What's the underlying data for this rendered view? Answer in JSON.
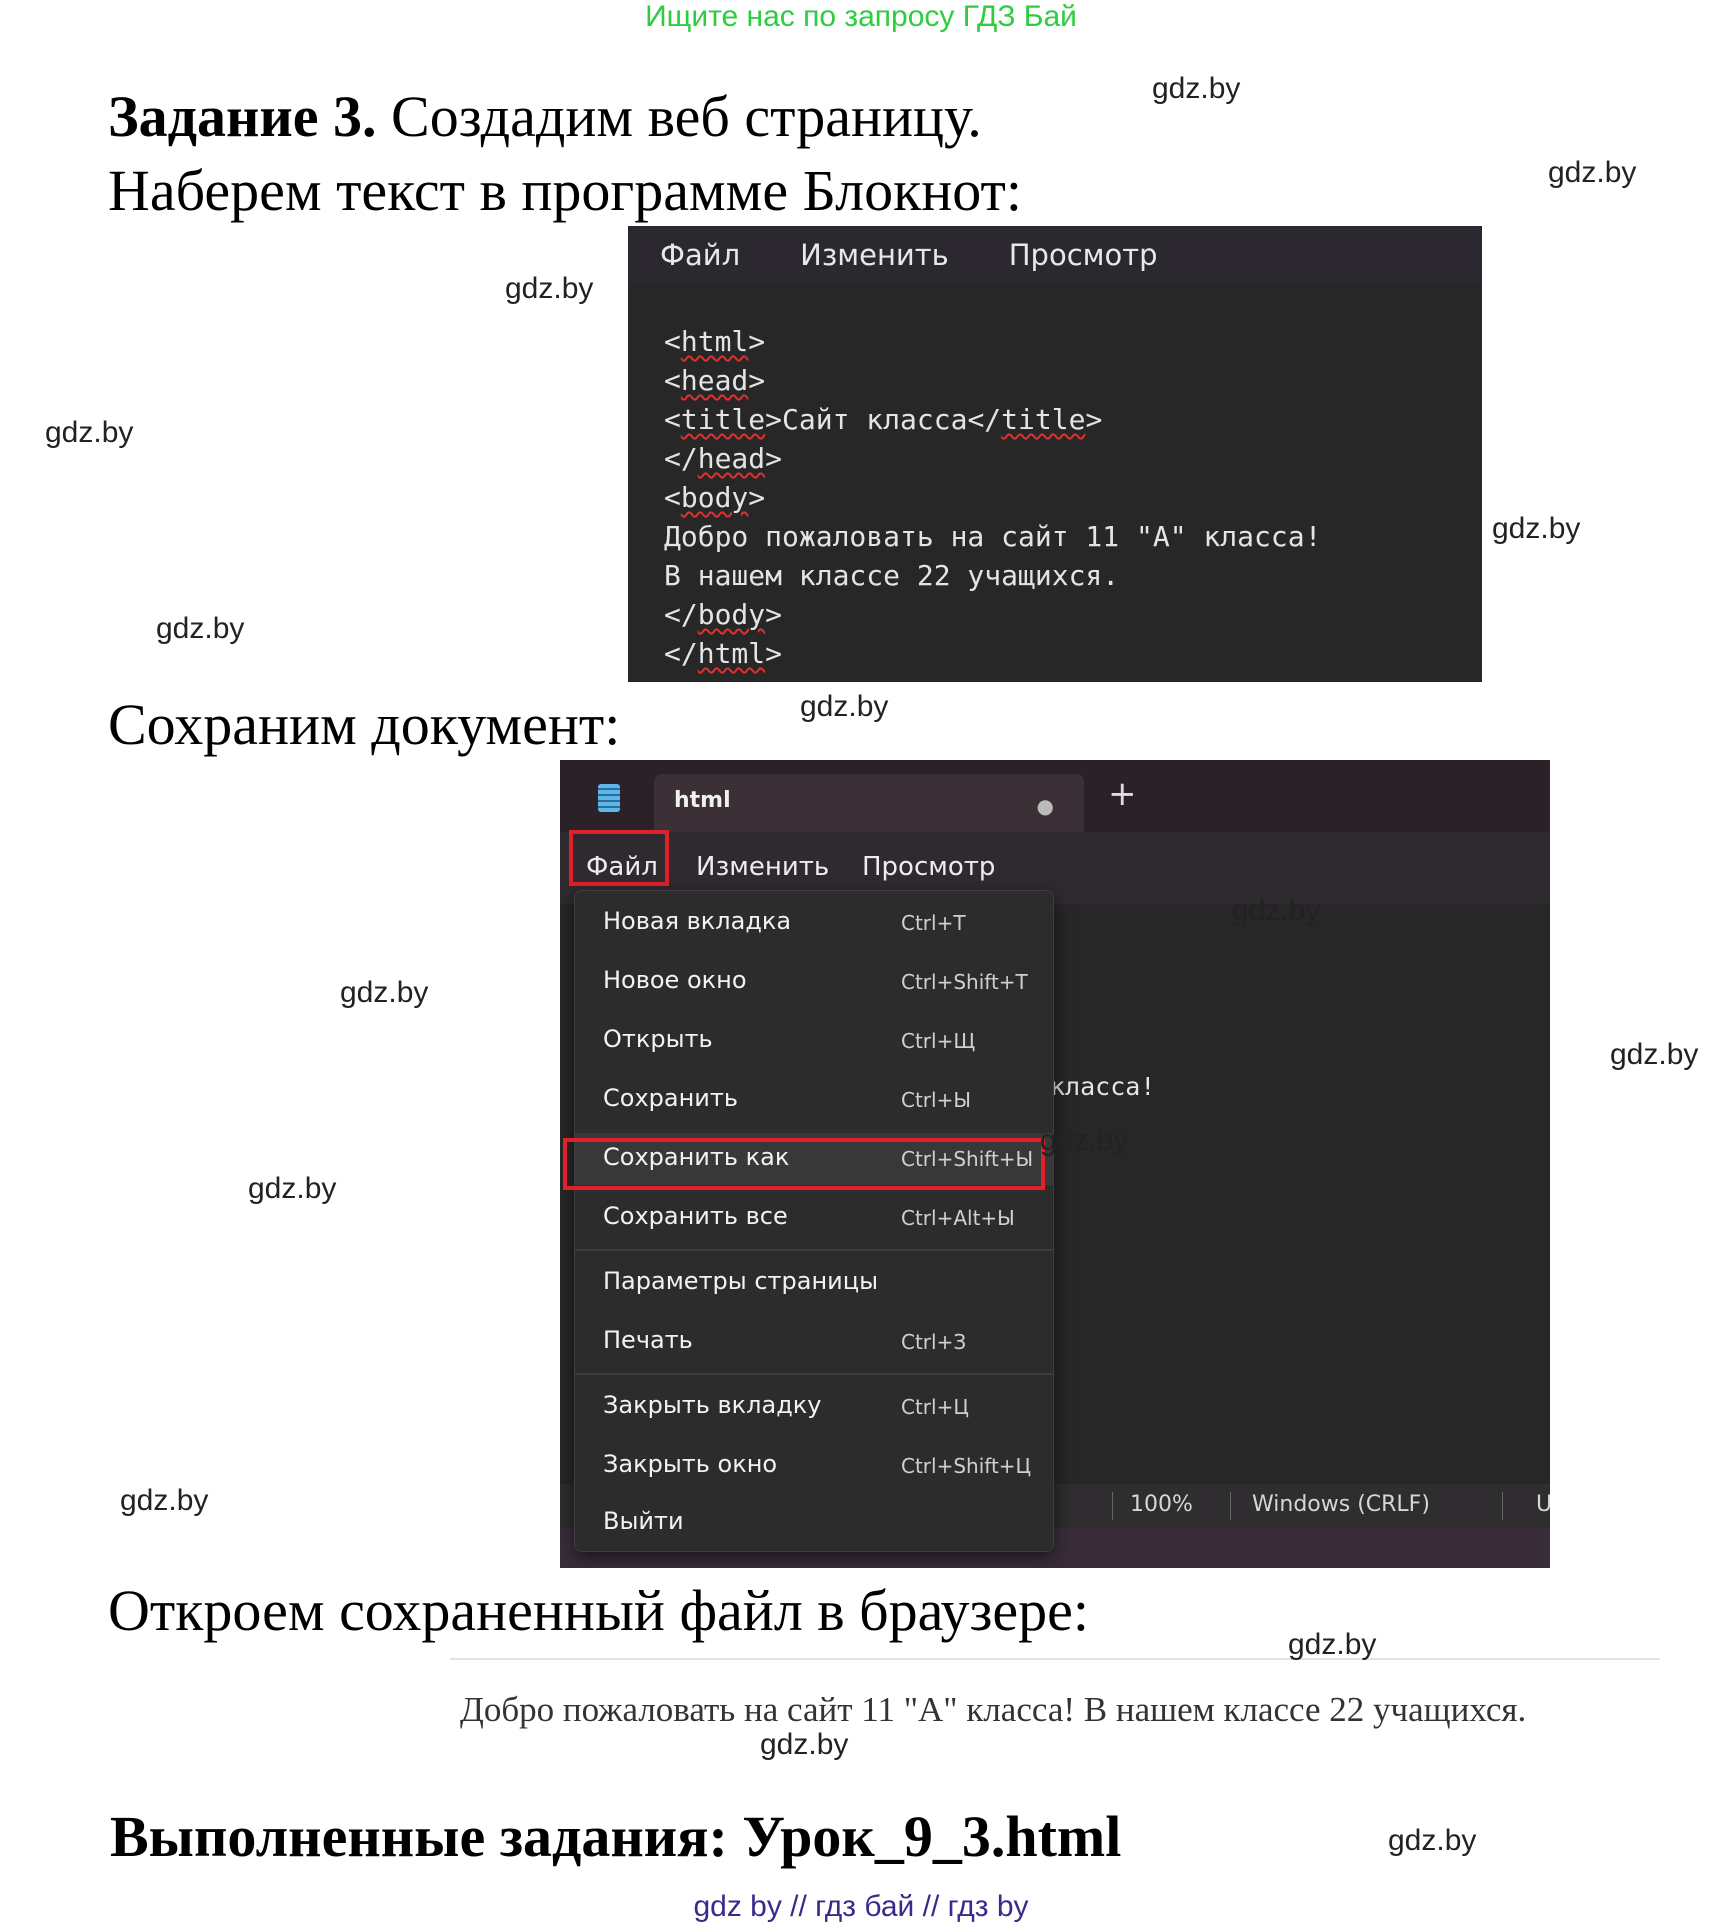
{
  "banner": "Ищите нас по запросу ГДЗ Бай",
  "task": {
    "label": "Задание 3.",
    "title": " Создадим веб страницу.",
    "line2": "Наберем текст в программе Блокнот:",
    "save_heading": "Сохраним документ:",
    "open_heading": "Откроем сохраненный файл в браузере:",
    "done": "Выполненные задания: Урок_9_3.html"
  },
  "watermark": "gdz.by",
  "notepad1": {
    "menu": [
      "Файл",
      "Изменить",
      "Просмотр"
    ],
    "code": {
      "l1": "html",
      "l2": "head",
      "l3a": "title",
      "l3b": "Сайт класса",
      "l3c": "title",
      "l4": "head",
      "l5": "body",
      "l6": "Добро пожаловать на сайт 11 \"А\" класса!",
      "l7": "В нашем классе 22 учащихся.",
      "l8": "body",
      "l9": "html"
    }
  },
  "notepad2": {
    "tab_title": "html",
    "tab_dot": "●",
    "plus": "+",
    "menu": [
      "Файл",
      "Изменить",
      "Просмотр"
    ],
    "editor_fragment": "класса!",
    "status": [
      "100%",
      "Windows (CRLF)",
      "U"
    ],
    "file_menu": [
      {
        "label": "Новая вкладка",
        "shortcut": "Ctrl+T"
      },
      {
        "label": "Новое окно",
        "shortcut": "Ctrl+Shift+T"
      },
      {
        "label": "Открыть",
        "shortcut": "Ctrl+Щ"
      },
      {
        "label": "Сохранить",
        "shortcut": "Ctrl+Ы"
      },
      {
        "label": "Сохранить как",
        "shortcut": "Ctrl+Shift+Ы"
      },
      {
        "label": "Сохранить все",
        "shortcut": "Ctrl+Alt+Ы"
      },
      {
        "label": "Параметры страницы",
        "shortcut": ""
      },
      {
        "label": "Печать",
        "shortcut": "Ctrl+З"
      },
      {
        "label": "Закрыть вкладку",
        "shortcut": "Ctrl+Ц"
      },
      {
        "label": "Закрыть окно",
        "shortcut": "Ctrl+Shift+Ц"
      },
      {
        "label": "Выйти",
        "shortcut": ""
      }
    ]
  },
  "browser_text": "Добро пожаловать на сайт 11 \"А\" класса! В нашем классе 22 учащихся.",
  "footer": "gdz by  //  гдз бай  //  гдз by"
}
